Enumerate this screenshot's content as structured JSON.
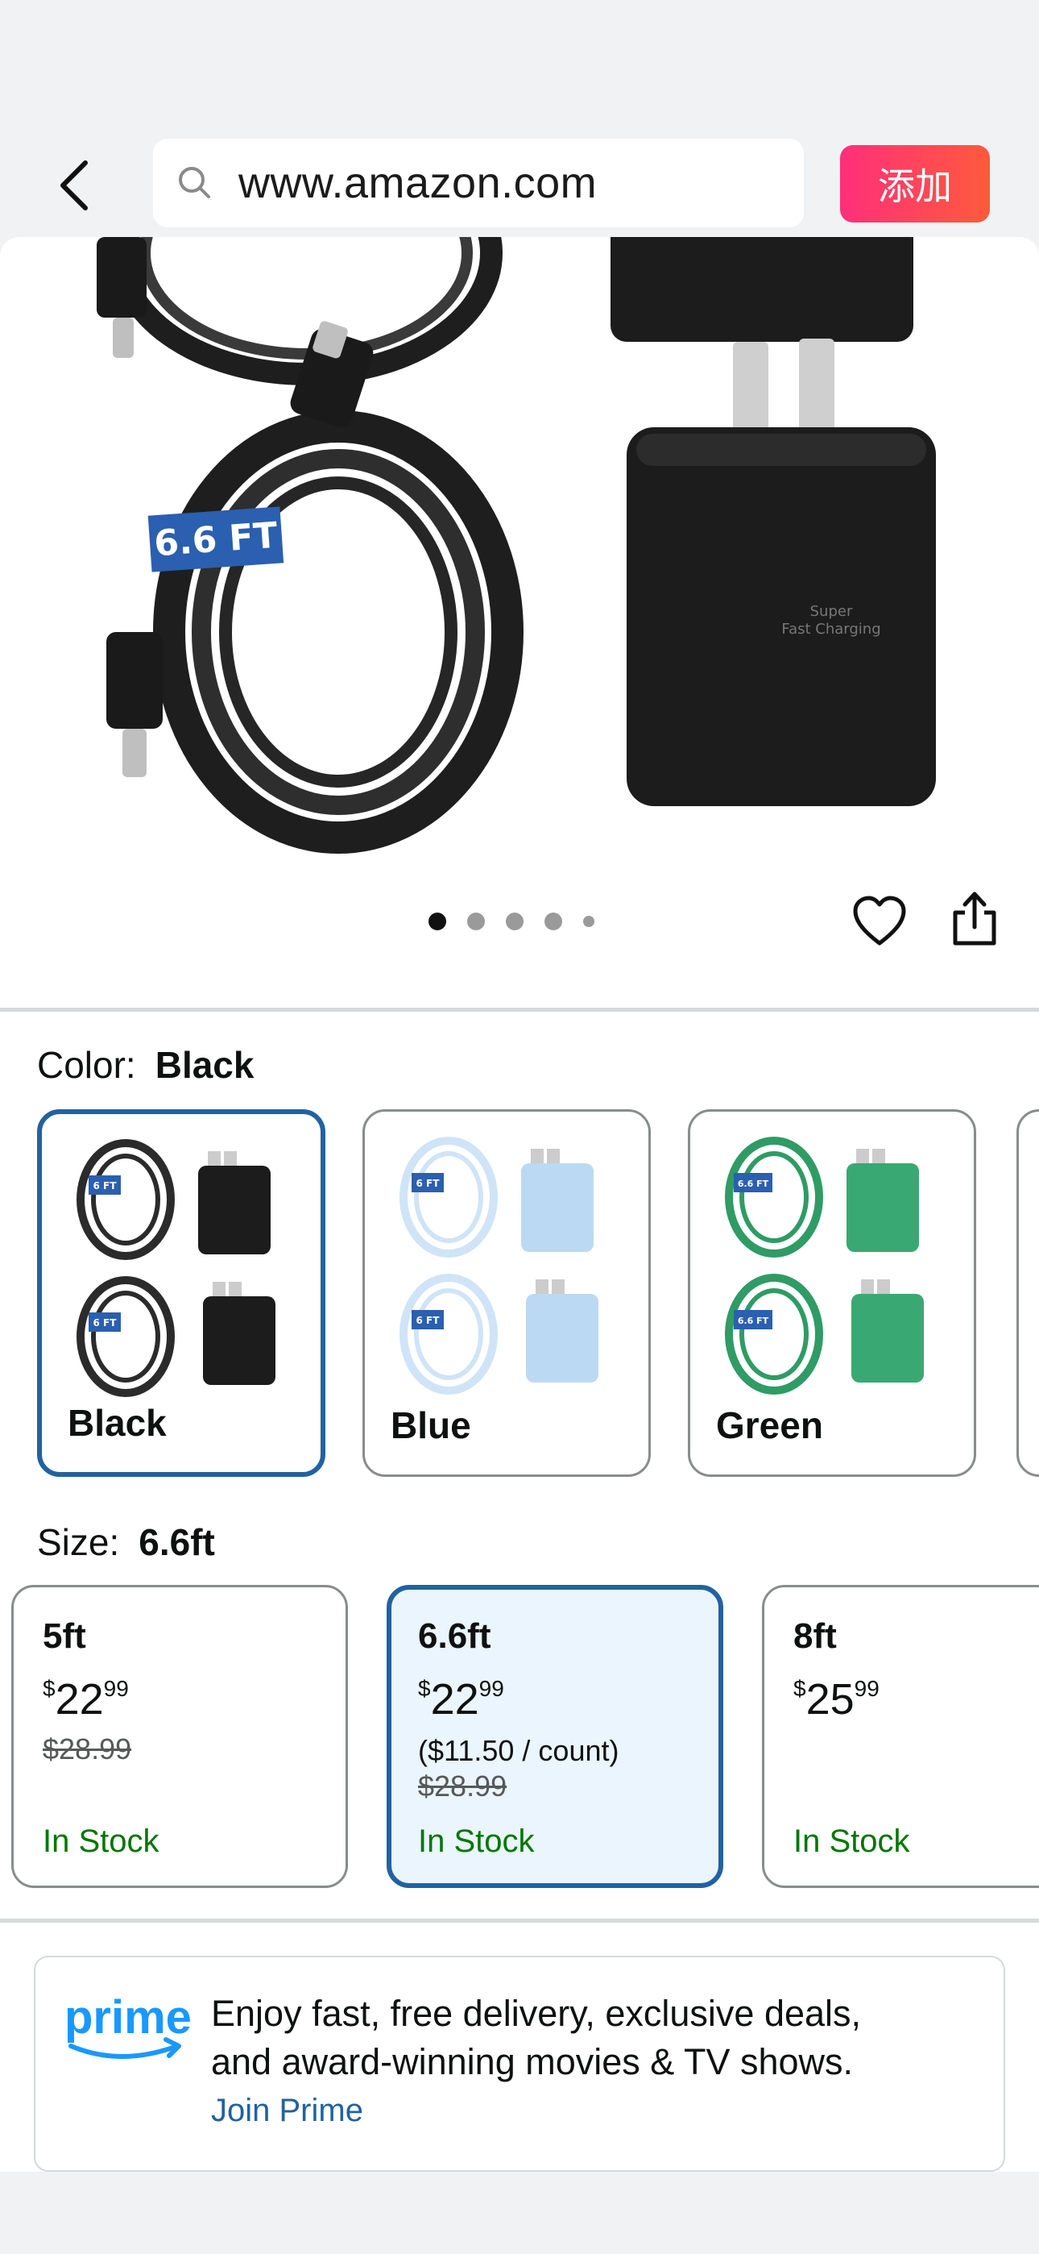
{
  "browser": {
    "url": "www.amazon.com",
    "add_button": "添加"
  },
  "gallery": {
    "image_label": "6.6 FT",
    "charger_text_1": "Super",
    "charger_text_2": "Fast Charging",
    "dot_count": 5,
    "active_dot": 0
  },
  "color": {
    "label": "Color:",
    "selected": "Black",
    "options": [
      {
        "label": "Black",
        "tag": "6 FT",
        "cable": "#2b2b2b",
        "charger": "#1c1c1c",
        "tag_color": "#2b5fb0"
      },
      {
        "label": "Blue",
        "tag": "6 FT",
        "cable": "#cfe4f7",
        "charger": "#bcd9f3",
        "tag_color": "#2b5fb0"
      },
      {
        "label": "Green",
        "tag": "6.6 FT",
        "cable": "#2f9b65",
        "charger": "#3aa872",
        "tag_color": "#2b5fb0"
      }
    ]
  },
  "size": {
    "label": "Size:",
    "selected": "6.6ft",
    "options": [
      {
        "name": "5ft",
        "currency": "$",
        "dollars": "22",
        "cents": "99",
        "unit": "",
        "list_price": "$28.99",
        "stock": "In Stock"
      },
      {
        "name": "6.6ft",
        "currency": "$",
        "dollars": "22",
        "cents": "99",
        "unit": "($11.50 / count)",
        "list_price": "$28.99",
        "stock": "In Stock"
      },
      {
        "name": "8ft",
        "currency": "$",
        "dollars": "25",
        "cents": "99",
        "unit": "",
        "list_price": "",
        "stock": "In Stock"
      }
    ]
  },
  "prime": {
    "logo_text": "prime",
    "line1": "Enjoy fast, free delivery, exclusive deals,",
    "line2": "and award-winning movies & TV shows.",
    "link": "Join Prime"
  },
  "colors": {
    "accent_blue": "#2162a1",
    "stock_green": "#007600",
    "prime_blue": "#1a98ff",
    "add_button_gradient": "#ff2f7b"
  }
}
